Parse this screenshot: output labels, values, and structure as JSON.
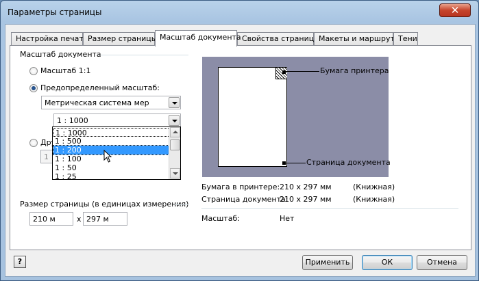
{
  "window": {
    "title": "Параметры страницы",
    "close_glyph": "✕"
  },
  "tabs": [
    {
      "label": "Настройка печати",
      "active": false
    },
    {
      "label": "Размер страницы",
      "active": false
    },
    {
      "label": "Масштаб документа",
      "active": true
    },
    {
      "label": "Свойства страницы",
      "active": false
    },
    {
      "label": "Макеты и маршруты",
      "active": false
    },
    {
      "label": "Тени",
      "active": false
    }
  ],
  "scale_group": {
    "title": "Масштаб документа",
    "radio_1to1": {
      "label": "Масштаб 1:1",
      "checked": false
    },
    "radio_predefined": {
      "label": "Предопределенный масштаб:",
      "checked": true
    },
    "system_select": {
      "value": "Метрическая система мер"
    },
    "scale_select": {
      "value": "1 : 1000"
    },
    "radio_other": {
      "label": "Дру",
      "checked": false
    },
    "other_field": {
      "value": "1 "
    }
  },
  "scale_dropdown": {
    "options": [
      "1 : 1000",
      "1 : 500",
      "1 : 200",
      "1 : 100",
      "1 : 50",
      "1 : 25"
    ],
    "highlighted": "1 : 200"
  },
  "page_size_group": {
    "title": "Размер страницы (в единицах измерения)",
    "width": "210 м",
    "separator": "x",
    "height": "297 м"
  },
  "preview": {
    "printer_paper_label": "Бумага принтера",
    "drawing_page_label": "Страница документа"
  },
  "info": {
    "printer_paper": {
      "label": "Бумага в принтере:",
      "size": "210 x 297 мм",
      "orientation": "(Книжная)"
    },
    "drawing_page": {
      "label": "Страница документа:",
      "size": "210 x 297 мм",
      "orientation": "(Книжная)"
    },
    "scale": {
      "label": "Масштаб:",
      "value": "Нет"
    }
  },
  "footer": {
    "help_glyph": "?",
    "apply_label": "Применить",
    "ok_label": "ОК",
    "cancel_label": "Отмена"
  },
  "colors": {
    "selection": "#3399ff",
    "preview_bg": "#8b8da7",
    "close_button": "#c7452c"
  }
}
